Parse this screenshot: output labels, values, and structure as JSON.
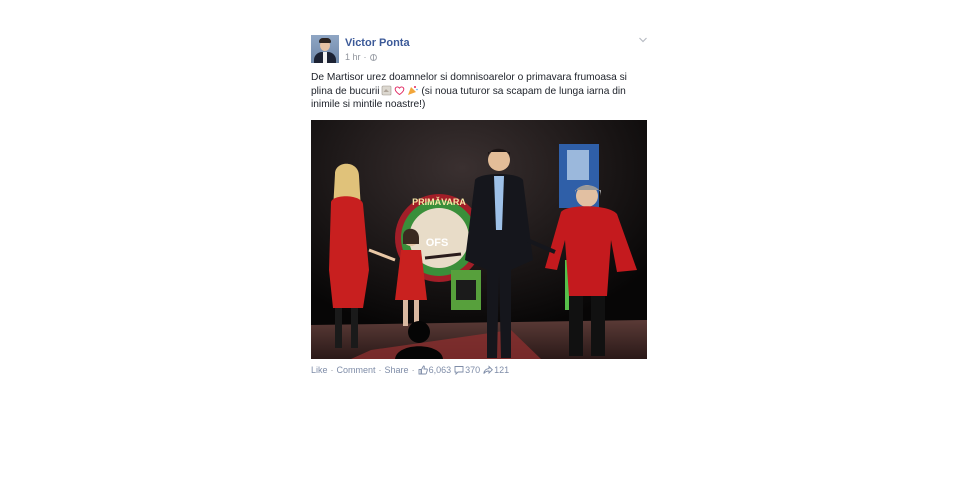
{
  "post": {
    "author": "Victor Ponta",
    "time": "1 hr",
    "meta_separator": "·",
    "text_line1": "De Martisor urez doamnelor si domnisoarelor o primavara frumoasa si plina de bucurii",
    "text_line2": " (si noua tuturor sa scapam de lunga iarna din inimile si mintile noastre!)",
    "emojis": [
      "shoe-emoji",
      "heart-emoji",
      "party-emoji"
    ]
  },
  "photo": {
    "banner_text": "PRIMĂVARA",
    "banner_text2": "OFS"
  },
  "actions": {
    "like": "Like",
    "comment": "Comment",
    "share": "Share",
    "separator": "·",
    "likes": "6,063",
    "comments": "370",
    "shares": "121"
  },
  "colors": {
    "link": "#3b5998",
    "meta": "#90949c",
    "action": "#7f8da8"
  }
}
